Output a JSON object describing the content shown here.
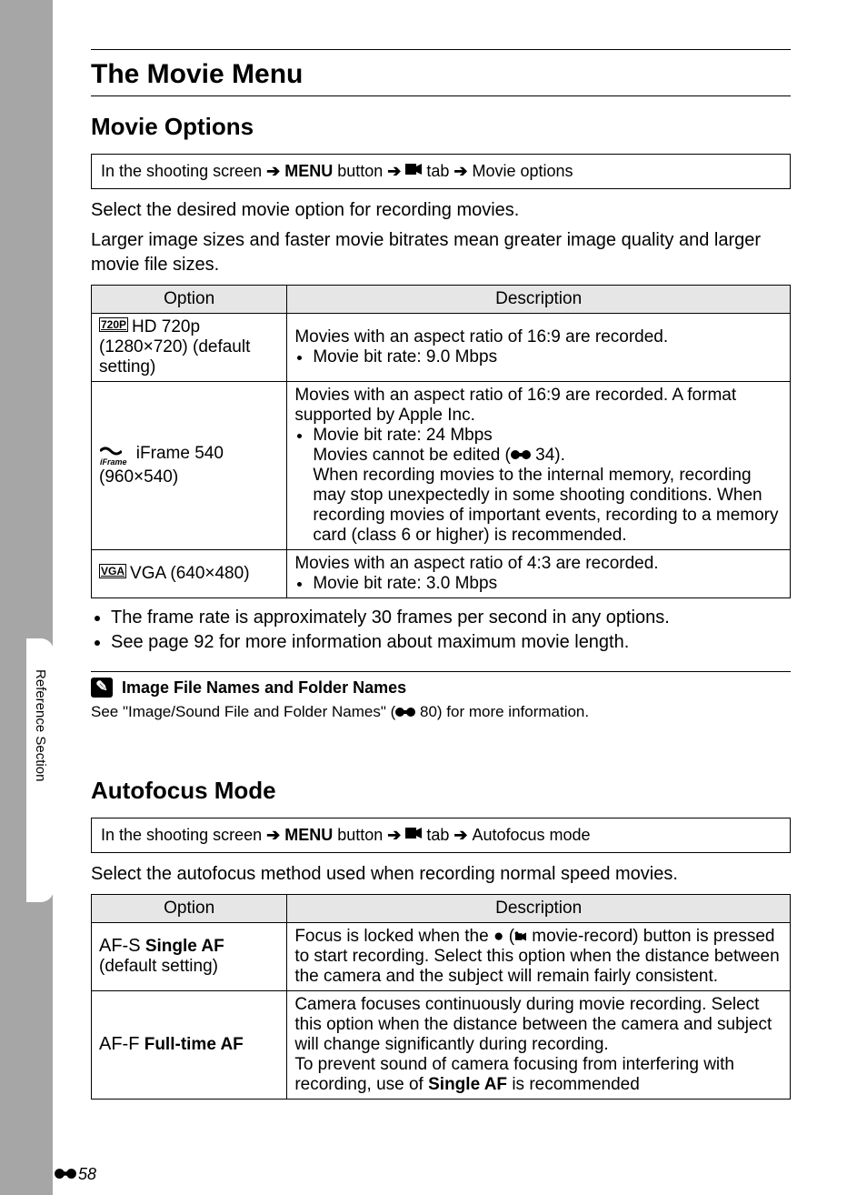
{
  "chapterTitle": "The Movie Menu",
  "section1": {
    "title": "Movie Options",
    "breadcrumb": {
      "pre": "In the shooting screen",
      "menu": "MENU",
      "button": "button",
      "tab": "tab",
      "dest": "Movie options"
    },
    "para1": "Select the desired movie option for recording movies.",
    "para2": "Larger image sizes and faster movie bitrates mean greater image quality and larger movie file sizes.",
    "tableHeaders": {
      "c1": "Option",
      "c2": "Description"
    },
    "rows": [
      {
        "optIcon": "720P",
        "optLabel": "HD 720p (1280×720) (default setting)",
        "desc1": "Movies with an aspect ratio of 16:9 are recorded.",
        "bullet1": "Movie bit rate: 9.0 Mbps"
      },
      {
        "optIcon": "iFrame",
        "optLabel": "iFrame 540 (960×540)",
        "desc1": "Movies with an aspect ratio of 16:9 are recorded. A format supported by Apple Inc.",
        "bullet1": "Movie bit rate: 24 Mbps",
        "more1": "Movies cannot be edited (",
        "moreRef": "34).",
        "more2": "When recording movies to the internal memory, recording may stop unexpectedly in some shooting conditions. When recording movies of important events, recording to a memory card (class 6 or higher) is recommended."
      },
      {
        "optIcon": "VGA",
        "optLabel": "VGA (640×480)",
        "desc1": "Movies with an aspect ratio of 4:3 are recorded.",
        "bullet1": "Movie bit rate: 3.0 Mbps"
      }
    ],
    "postNotes": [
      "The frame rate is approximately 30 frames per second in any options.",
      "See page 92 for more information about maximum movie length."
    ],
    "note": {
      "heading": "Image File Names and Folder Names",
      "textPre": "See \"Image/Sound File and Folder Names\" (",
      "textRef": "80) for more information."
    }
  },
  "section2": {
    "title": "Autofocus Mode",
    "breadcrumb": {
      "pre": "In the shooting screen",
      "menu": "MENU",
      "button": "button",
      "tab": "tab",
      "dest": "Autofocus mode"
    },
    "para1": "Select the autofocus method used when recording normal speed movies.",
    "tableHeaders": {
      "c1": "Option",
      "c2": "Description"
    },
    "rows": [
      {
        "badge": "AF-S",
        "labelBold": "Single AF",
        "labelTail": " (default setting)",
        "descPre": "Focus is locked when the ",
        "descMid": " (",
        "descMid2": " movie-record) button is pressed to start recording. Select this option when the distance between the camera and the subject will remain fairly consistent."
      },
      {
        "badge": "AF-F",
        "labelBold": "Full-time AF",
        "labelTail": "",
        "desc1": "Camera focuses continuously during movie recording. Select this option when the distance between the camera and subject will change significantly during recording.",
        "desc2a": "To prevent sound of camera focusing from interfering with recording, use of ",
        "desc2bold": "Single AF",
        "desc2b": " is recommended"
      }
    ]
  },
  "sideTab": "Reference Section",
  "pageNumber": "58"
}
